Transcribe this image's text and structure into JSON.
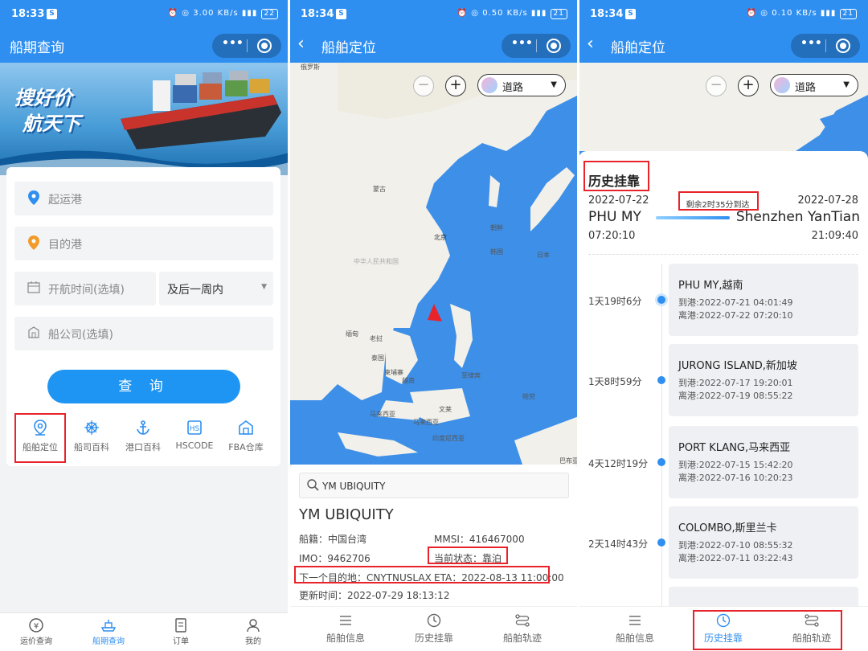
{
  "status": {
    "p1": {
      "time": "18:33",
      "net": "3.00 KB/s",
      "batt": "22"
    },
    "p2": {
      "time": "18:34",
      "net": "0.50 KB/s",
      "batt": "21"
    },
    "p3": {
      "time": "18:34",
      "net": "0.10 KB/s",
      "batt": "21"
    }
  },
  "panel1": {
    "title": "船期查询",
    "banner": {
      "line1": "搜好价",
      "line2": "航天下"
    },
    "fields": {
      "origin": "起运港",
      "destination": "目的港",
      "sail_time": "开航时间(选填)",
      "range": "及后一周内",
      "carrier": "船公司(选填)"
    },
    "search_button": "查 询",
    "quick": [
      {
        "label": "船舶定位",
        "icon": "location-pin-icon"
      },
      {
        "label": "船司百科",
        "icon": "ship-wheel-icon"
      },
      {
        "label": "港口百科",
        "icon": "anchor-icon"
      },
      {
        "label": "HSCODE",
        "icon": "hscode-icon"
      },
      {
        "label": "FBA仓库",
        "icon": "warehouse-icon"
      }
    ],
    "tabs": [
      {
        "label": "运价查询",
        "icon": "yen-icon"
      },
      {
        "label": "船期查询",
        "icon": "ship-icon"
      },
      {
        "label": "订单",
        "icon": "order-icon"
      },
      {
        "label": "我的",
        "icon": "user-icon"
      }
    ],
    "active_tab": "船期查询"
  },
  "panel2": {
    "title": "船舶定位",
    "layer": "道路",
    "map_labels": {
      "mongolia": "蒙古",
      "beijing": "北京",
      "china": "中华人民共和国",
      "korea_n": "朝鲜",
      "korea_s": "韩国",
      "japan": "日本",
      "myanmar": "缅甸",
      "laos": "老挝",
      "thailand": "泰国",
      "cambodia": "柬埔寨",
      "vietnam": "越南",
      "philippines": "菲律宾",
      "malaysia": "马来西亚",
      "malaysia2": "马来西亚",
      "brunei": "文莱",
      "indonesia": "印度尼西亚",
      "palau": "帕劳",
      "russia": "俄罗斯",
      "png": "巴布亚"
    },
    "search_value": "YM UBIQUITY",
    "vessel_name": "YM UBIQUITY",
    "info": {
      "flag": "船籍：中国台湾",
      "mmsi": "MMSI：416467000",
      "imo": "IMO：9462706",
      "state": "当前状态：靠泊",
      "next_dest": "下一个目的地：CNYTNUSLAX",
      "eta": "ETA：2022-08-13 11:00:00",
      "updated": "更新时间：2022-07-29 18:13:12"
    }
  },
  "panel3": {
    "title": "船舶定位",
    "layer": "道路",
    "section_title": "历史挂靠",
    "from": {
      "date": "2022-07-22",
      "port": "PHU MY",
      "time": "07:20:10"
    },
    "to": {
      "date": "2022-07-28",
      "port": "Shenzhen YanTian",
      "time": "21:09:40"
    },
    "remaining": "剩余2时35分到达",
    "stops": [
      {
        "duration": "1天19时6分",
        "port": "PHU MY,越南",
        "arrive": "到港:2022-07-21 04:01:49",
        "depart": "离港:2022-07-22 07:20:10"
      },
      {
        "duration": "1天8时59分",
        "port": "JURONG ISLAND,新加坡",
        "arrive": "到港:2022-07-17 19:20:01",
        "depart": "离港:2022-07-19 08:55:22"
      },
      {
        "duration": "4天12时19分",
        "port": "PORT KLANG,马来西亚",
        "arrive": "到港:2022-07-15 15:42:20",
        "depart": "离港:2022-07-16 10:20:23"
      },
      {
        "duration": "2天14时43分",
        "port": "COLOMBO,斯里兰卡",
        "arrive": "到港:2022-07-10 08:55:32",
        "depart": "离港:2022-07-11 03:22:43"
      }
    ]
  },
  "bottom_nav": [
    {
      "label": "船舶信息",
      "icon": "menu-icon"
    },
    {
      "label": "历史挂靠",
      "icon": "clock-icon"
    },
    {
      "label": "船舶轨迹",
      "icon": "route-icon"
    }
  ],
  "colors": {
    "primary": "#2f8ff0",
    "highlight": "#e8232a",
    "sea": "#3d8fe8",
    "land": "#f1f0ea"
  }
}
